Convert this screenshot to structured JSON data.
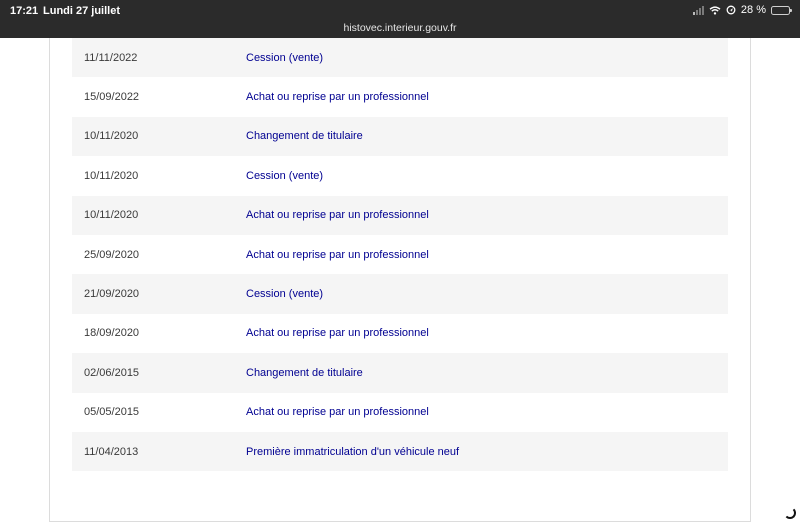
{
  "statusbar": {
    "time": "17:21",
    "date": "Lundi 27 juillet",
    "url": "histovec.interieur.gouv.fr",
    "battery": "28 %",
    "battery_level": 0.28
  },
  "history": {
    "rows": [
      {
        "date": "11/11/2022",
        "operation": "Cession (vente)"
      },
      {
        "date": "15/09/2022",
        "operation": "Achat ou reprise par un professionnel"
      },
      {
        "date": "10/11/2020",
        "operation": "Changement de titulaire"
      },
      {
        "date": "10/11/2020",
        "operation": "Cession (vente)"
      },
      {
        "date": "10/11/2020",
        "operation": "Achat ou reprise par un professionnel"
      },
      {
        "date": "25/09/2020",
        "operation": "Achat ou reprise par un professionnel"
      },
      {
        "date": "21/09/2020",
        "operation": "Cession (vente)"
      },
      {
        "date": "18/09/2020",
        "operation": "Achat ou reprise par un professionnel"
      },
      {
        "date": "02/06/2015",
        "operation": "Changement de titulaire"
      },
      {
        "date": "05/05/2015",
        "operation": "Achat ou reprise par un professionnel"
      },
      {
        "date": "11/04/2013",
        "operation": "Première immatriculation d'un véhicule neuf"
      }
    ]
  },
  "colors": {
    "link": "#000091",
    "row_alt": "#f5f5f5",
    "statusbar_bg": "#2b2b2b"
  },
  "icons": [
    "signal-icon",
    "wifi-icon",
    "location-icon",
    "battery-icon",
    "spinner-icon"
  ]
}
